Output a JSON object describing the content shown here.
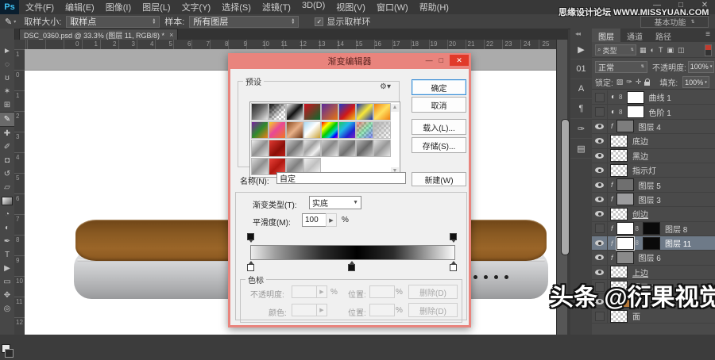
{
  "window": {
    "controls": [
      {
        "name": "minimize",
        "glyph": "—"
      },
      {
        "name": "restore",
        "glyph": "□"
      },
      {
        "name": "close",
        "glyph": "✕"
      }
    ]
  },
  "menu_bar": {
    "logo": "Ps",
    "items": [
      "文件(F)",
      "编辑(E)",
      "图像(I)",
      "图层(L)",
      "文字(Y)",
      "选择(S)",
      "滤镜(T)",
      "3D(D)",
      "视图(V)",
      "窗口(W)",
      "帮助(H)"
    ]
  },
  "options_bar": {
    "sample_size_label": "取样大小:",
    "sample_size_value": "取样点",
    "sample_label": "样本:",
    "sample_value": "所有图层",
    "show_ring_checked": "✓",
    "show_ring_label": "显示取样环",
    "workspace_label": "基本功能"
  },
  "watermark_top": "思缘设计论坛 WWW.MISSYUAN.COM",
  "watermark_bottom": "头条 @衍果视觉",
  "document_tab": {
    "title": "DSC_0360.psd @ 33.3% (图层 11, RGB/8) *",
    "close": "×"
  },
  "toolbar": {
    "tools": [
      {
        "name": "move-tool",
        "glyph": "►"
      },
      {
        "name": "marquee-tool",
        "glyph": "◌"
      },
      {
        "name": "lasso-tool",
        "glyph": "ʊ"
      },
      {
        "name": "magic-wand-tool",
        "glyph": "✶"
      },
      {
        "name": "crop-tool",
        "glyph": "⊞"
      },
      {
        "name": "eyedropper-tool",
        "glyph": "✎",
        "selected": true
      },
      {
        "name": "healing-brush-tool",
        "glyph": "✚"
      },
      {
        "name": "brush-tool",
        "glyph": "✐"
      },
      {
        "name": "clone-stamp-tool",
        "glyph": "◘"
      },
      {
        "name": "history-brush-tool",
        "glyph": "↺"
      },
      {
        "name": "eraser-tool",
        "glyph": "▱"
      },
      {
        "name": "gradient-tool",
        "glyph": "",
        "special": "gradient"
      },
      {
        "name": "blur-tool",
        "glyph": "◔"
      },
      {
        "name": "dodge-tool",
        "glyph": "◐"
      },
      {
        "name": "pen-tool",
        "glyph": "✒"
      },
      {
        "name": "type-tool",
        "glyph": "T"
      },
      {
        "name": "path-select-tool",
        "glyph": "▶"
      },
      {
        "name": "shape-tool",
        "glyph": "▭"
      },
      {
        "name": "hand-tool",
        "glyph": "✥"
      },
      {
        "name": "zoom-tool",
        "glyph": "◎"
      }
    ]
  },
  "rulers": {
    "horizontal": [
      "0",
      "1",
      "2",
      "3",
      "4",
      "5",
      "6",
      "7",
      "8",
      "9",
      "10",
      "11",
      "12",
      "13",
      "14",
      "15",
      "16",
      "17",
      "18",
      "19",
      "20",
      "21",
      "22",
      "23",
      "24",
      "25"
    ],
    "vertical": [
      "1",
      "0",
      "1",
      "2",
      "3",
      "4",
      "5",
      "6",
      "7",
      "8",
      "9",
      "10",
      "11",
      "12"
    ]
  },
  "canvas": {
    "box_top_color": "#8a5a22",
    "box_body_color": "#c6c7c9",
    "dot_count": 4
  },
  "dialog": {
    "title": "渐变编辑器",
    "controls": [
      {
        "name": "minimize",
        "glyph": "—"
      },
      {
        "name": "restore",
        "glyph": "□"
      },
      {
        "name": "close",
        "glyph": "✕"
      }
    ],
    "presets_label": "预设",
    "gear_icon": "⚙▾",
    "scroll_up": "▲",
    "scroll_down": "▼",
    "swatches": [
      {
        "g": "linear-gradient(135deg,#2a2a2a 0%,#6a6a6a 45%,#e8e8e8 100%)"
      },
      {
        "g": "linear-gradient(135deg,rgba(0,0,0,.95),rgba(0,0,0,0) 70%)",
        "t": true
      },
      {
        "g": "linear-gradient(135deg,#f5f5f5 0%,#111 50%,#f5f5f5 100%)"
      },
      {
        "g": "linear-gradient(135deg,#cf1020,#0a6b2d)"
      },
      {
        "g": "linear-gradient(135deg,#5a2a9d,#e87510)"
      },
      {
        "g": "linear-gradient(135deg,#2038c8,#d01818 55%,#f5c518)"
      },
      {
        "g": "linear-gradient(135deg,#1830b0,#f8e838 50%,#1830b0)"
      },
      {
        "g": "linear-gradient(135deg,#f08010,#ffe060 50%,#f08010)"
      },
      {
        "g": "linear-gradient(135deg,#7a1fa0,#2e8b2e 50%,#f08018)"
      },
      {
        "g": "linear-gradient(135deg,#f8d020,#e84898 45%,#f07820)"
      },
      {
        "g": "linear-gradient(135deg,#8a4a20,#e8b088 50%,#6a3415)"
      },
      {
        "g": "linear-gradient(135deg,#a8d8f0,#ffffff 45%,#c8a030)"
      },
      {
        "g": "linear-gradient(135deg,#f00,#ff0 25%,#0c0 50%,#0cc 70%,#00f 85%,#c0c)"
      },
      {
        "g": "linear-gradient(135deg,#20c860 0%,#20b8e8 35%,#2020d0 70%,#8020c0 100%)"
      },
      {
        "g": "linear-gradient(135deg,rgba(255,0,0,.45),rgba(0,200,80,.4),rgba(0,0,255,.45))",
        "t": true
      },
      {
        "g": "linear-gradient(135deg,#b0b0b0,rgba(176,176,176,0))",
        "t": true
      },
      {
        "g": "linear-gradient(135deg,#f0f0f0,#909090 50%,#e0e0e0)"
      },
      {
        "g": "linear-gradient(135deg,#e03830,#8a0f08 60%,#c02018)"
      },
      {
        "g": "linear-gradient(135deg,#c8c8c8,#787878 50%,#d8d8d8)"
      },
      {
        "g": "linear-gradient(135deg,#e8e8e8,#a0a0a0 40%,#f0f0f0 70%,#909090)"
      },
      {
        "g": "linear-gradient(135deg,#d0d0d0,#888888 45%,#e8e8e8)"
      },
      {
        "g": "linear-gradient(135deg,#c0c0c0,#707070 55%,#d0d0d0)"
      },
      {
        "g": "linear-gradient(135deg,#b8b8b8,#686868 50%,#c8c8c8)"
      },
      {
        "g": "linear-gradient(135deg,#e0e0e0,#989898 50%,#e8e8e8)"
      },
      {
        "g": "linear-gradient(135deg,#d8d8d8,#909090 50%,#e0e0e0)"
      },
      {
        "g": "linear-gradient(135deg,#e84038 0%,#b01810 50%,#e85048 100%)"
      },
      {
        "g": "linear-gradient(135deg,#c8c8c8,#808080 50%,#d8d8d8)"
      },
      {
        "g": "linear-gradient(135deg,#f0f0f0,#c0c0c0 50%,#f8f8f8)"
      }
    ],
    "buttons": {
      "ok": "确定",
      "cancel": "取消",
      "load": "载入(L)...",
      "save": "存储(S)..."
    },
    "name_label": "名称(N):",
    "name_value": "自定",
    "new_button": "新建(W)",
    "type_label": "渐变类型(T):",
    "type_value": "实底",
    "smooth_label": "平滑度(M):",
    "smooth_value": "100",
    "percent": "%",
    "preview_css": "linear-gradient(90deg,#ededed 0%,#9d9d9d 12%,#2c2c2c 35%,#000 52%,#2c2c2c 70%,#b8b8b8 90%,#fbfbfb 100%)",
    "stops": {
      "legend": "色标",
      "opacity_label": "不透明度:",
      "color_label": "颜色:",
      "location_label": "位置:",
      "delete_label": "删除(D)"
    }
  },
  "dock": {
    "strip_icons": [
      {
        "name": "actions-panel-icon",
        "glyph": "▶"
      },
      {
        "name": "info-panel-icon",
        "glyph": "01"
      },
      {
        "name": "character-panel-icon",
        "glyph": "A"
      },
      {
        "name": "paragraph-panel-icon",
        "glyph": "¶"
      },
      {
        "name": "brush-presets-panel-icon",
        "glyph": "✑"
      },
      {
        "name": "layer-comps-panel-icon",
        "glyph": "▤"
      }
    ],
    "panel": {
      "tabs": [
        {
          "label": "图层",
          "active": true
        },
        {
          "label": "通道",
          "active": false
        },
        {
          "label": "路径",
          "active": false
        }
      ],
      "filter_label": "类型",
      "filter_icons": [
        {
          "name": "pixel-filter-icon",
          "glyph": "▦"
        },
        {
          "name": "adjustment-filter-icon",
          "glyph": "◐"
        },
        {
          "name": "type-filter-icon",
          "glyph": "T"
        },
        {
          "name": "shape-filter-icon",
          "glyph": "▣"
        },
        {
          "name": "smart-object-filter-icon",
          "glyph": "◫"
        }
      ],
      "blend_mode": "正常",
      "opacity_label": "不透明度:",
      "opacity_value": "100%",
      "lock_label": "锁定:",
      "fill_label": "填充:",
      "fill_value": "100%",
      "layers": [
        {
          "label": "曲线 1",
          "eye": false,
          "thumb": "adj"
        },
        {
          "label": "色阶 1",
          "eye": false,
          "thumb": "adj"
        },
        {
          "label": "图层 4",
          "eye": true,
          "thumb": "fill",
          "color": "#7d7d7d",
          "clip": true
        },
        {
          "label": "底边",
          "eye": true,
          "thumb": "checker"
        },
        {
          "label": "黑边",
          "eye": true,
          "thumb": "checker"
        },
        {
          "label": "指示灯",
          "eye": true,
          "thumb": "checker"
        },
        {
          "label": "图层 5",
          "eye": true,
          "thumb": "fill",
          "color": "#6f6f6f",
          "clip": true
        },
        {
          "label": "图层 3",
          "eye": true,
          "thumb": "fill",
          "color": "#9c9c9e",
          "clip": true
        },
        {
          "label": "创边",
          "eye": true,
          "thumb": "checker",
          "underline": true
        },
        {
          "label": "图层 8",
          "eye": false,
          "thumb": "fill",
          "color": "#ffffff",
          "mask": true,
          "clip": true
        },
        {
          "label": "图层 11",
          "eye": true,
          "thumb": "fill",
          "color": "#ffffff",
          "mask": true,
          "clip": true,
          "selected": true
        },
        {
          "label": "图层 6",
          "eye": true,
          "thumb": "fill",
          "color": "#8a8a8a",
          "clip": true
        },
        {
          "label": "上边",
          "eye": true,
          "thumb": "checker",
          "underline": true
        },
        {
          "label": "图层 9",
          "eye": false,
          "thumb": "checker"
        },
        {
          "label": "",
          "eye": true,
          "thumb": "fill",
          "color": "#b87a3a",
          "clip": true
        },
        {
          "label": "面",
          "eye": false,
          "thumb": "checker"
        }
      ]
    }
  }
}
